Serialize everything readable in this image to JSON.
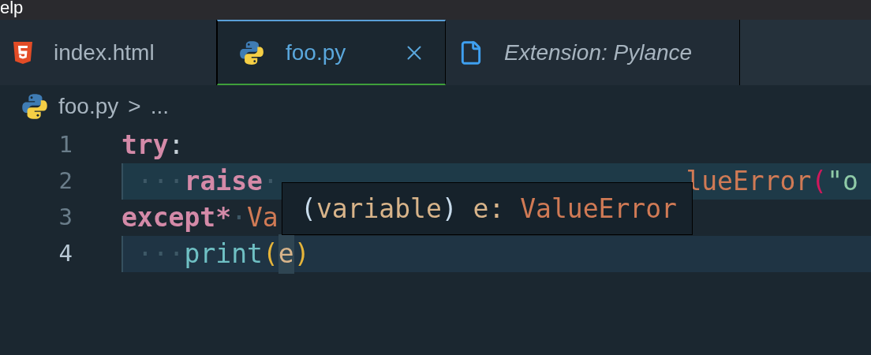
{
  "menu_bar": {
    "items": [
      "elp"
    ]
  },
  "tabs": [
    {
      "label": "index.html",
      "kind": "html",
      "selected": false,
      "preview": false
    },
    {
      "label": "foo.py",
      "kind": "python",
      "selected": true,
      "preview": false
    },
    {
      "label": "Extension: Pylance",
      "kind": "file",
      "selected": false,
      "preview": true
    }
  ],
  "breadcrumb": {
    "file": "foo.py",
    "separator": ">",
    "tail": "..."
  },
  "editor": {
    "lines": [
      {
        "number": "1",
        "highlighted": false,
        "current": false,
        "tokens": [
          {
            "text": "try",
            "kind": "keyword"
          },
          {
            "text": ":",
            "kind": "punct"
          }
        ]
      },
      {
        "number": "2",
        "highlighted": true,
        "current": false,
        "tokens": [
          {
            "text": "···",
            "kind": "ws"
          },
          {
            "text": "raise",
            "kind": "keyword"
          },
          {
            "text": "·",
            "kind": "ws"
          },
          {
            "kind": "covered"
          },
          {
            "text": "lueError",
            "kind": "class"
          },
          {
            "text": "(",
            "kind": "paren2"
          },
          {
            "text": "\"o",
            "kind": "string"
          }
        ]
      },
      {
        "number": "3",
        "highlighted": false,
        "current": false,
        "tokens": [
          {
            "text": "except*",
            "kind": "keyword"
          },
          {
            "text": "·",
            "kind": "ws"
          },
          {
            "text": "Va",
            "kind": "class"
          }
        ]
      },
      {
        "number": "4",
        "highlighted": false,
        "current": true,
        "tokens": [
          {
            "text": "···",
            "kind": "ws"
          },
          {
            "text": "print",
            "kind": "function"
          },
          {
            "text": "(",
            "kind": "paren"
          },
          {
            "text": "e",
            "kind": "variable_ref"
          },
          {
            "text": ")",
            "kind": "paren"
          }
        ]
      }
    ]
  },
  "hover": {
    "tokens": [
      {
        "text": "(",
        "kind": "bracket"
      },
      {
        "text": "variable",
        "kind": "param"
      },
      {
        "text": ")",
        "kind": "bracket"
      },
      {
        "text": " e: ",
        "kind": "param"
      },
      {
        "text": "ValueError",
        "kind": "class"
      }
    ]
  }
}
